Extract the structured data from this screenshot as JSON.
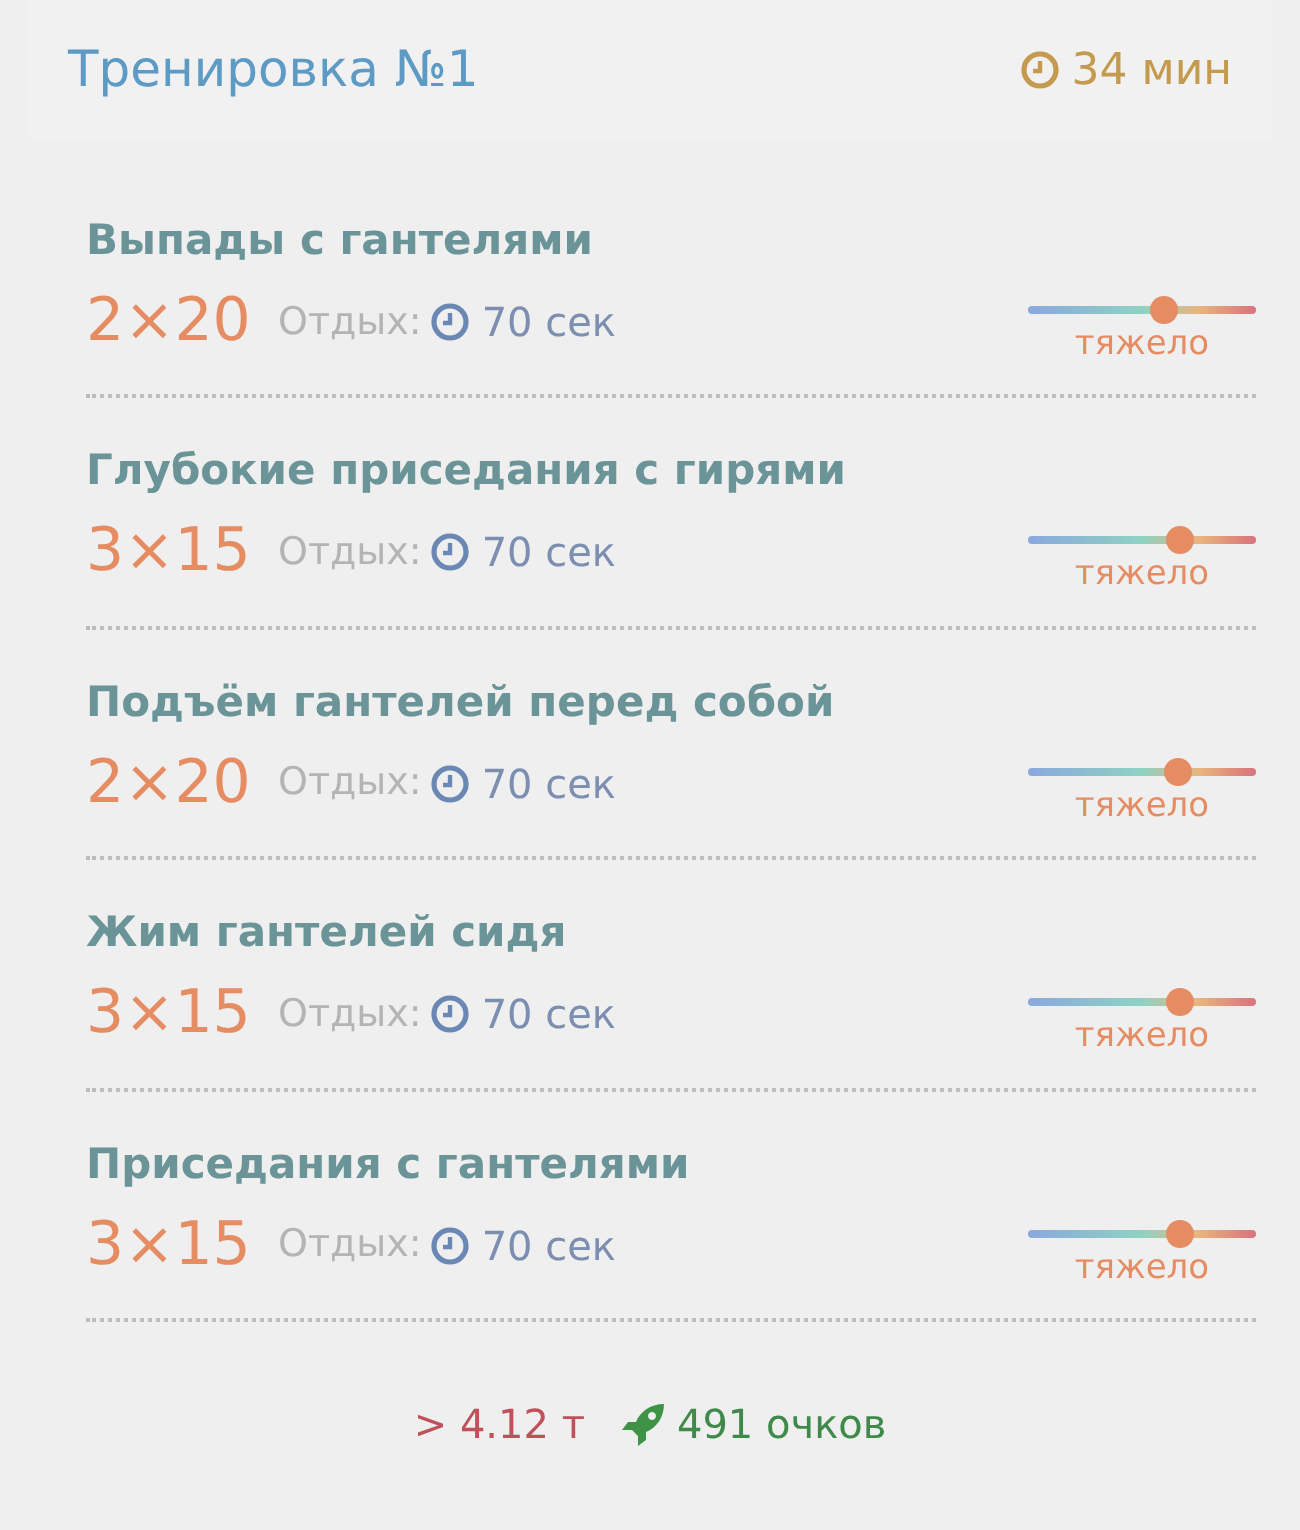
{
  "header": {
    "title": "Тренировка №1",
    "duration": "34 мин"
  },
  "exercises": [
    {
      "name": "Выпады с гантелями",
      "sets": "2×20",
      "rest_label": "Отдых:",
      "rest": "70 сек",
      "level": 0.6,
      "difficulty": "тяжело"
    },
    {
      "name": "Глубокие приседания с гирями",
      "sets": "3×15",
      "rest_label": "Отдых:",
      "rest": "70 сек",
      "level": 0.67,
      "difficulty": "тяжело"
    },
    {
      "name": "Подъём гантелей перед собой",
      "sets": "2×20",
      "rest_label": "Отдых:",
      "rest": "70 сек",
      "level": 0.66,
      "difficulty": "тяжело"
    },
    {
      "name": "Жим гантелей сидя",
      "sets": "3×15",
      "rest_label": "Отдых:",
      "rest": "70 сек",
      "level": 0.67,
      "difficulty": "тяжело"
    },
    {
      "name": "Приседания с гантелями",
      "sets": "3×15",
      "rest_label": "Отдых:",
      "rest": "70 сек",
      "level": 0.67,
      "difficulty": "тяжело"
    }
  ],
  "footer": {
    "weight": "> 4.12 т",
    "points": "491 очков"
  }
}
